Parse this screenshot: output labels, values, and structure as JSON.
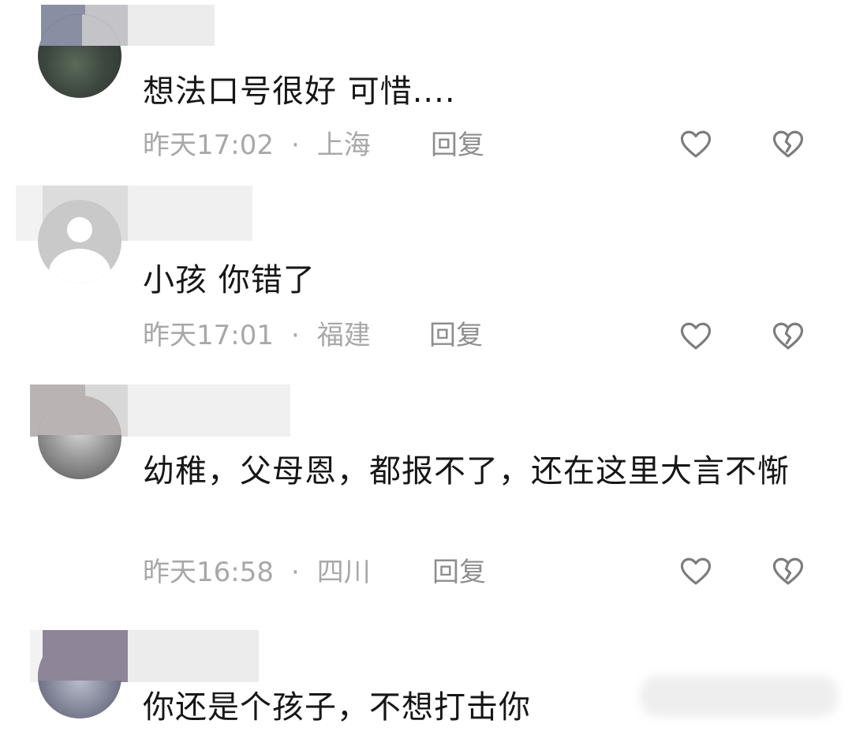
{
  "comments": [
    {
      "text": "想法口号很好 可惜....",
      "time": "昨天17:02",
      "separator": "·",
      "location": "上海",
      "reply_label": "回复",
      "like_icon": "heart-outline-icon",
      "dislike_icon": "broken-heart-icon"
    },
    {
      "text": "小孩 你错了",
      "time": "昨天17:01",
      "separator": "·",
      "location": "福建",
      "reply_label": "回复",
      "like_icon": "heart-outline-icon",
      "dislike_icon": "broken-heart-icon"
    },
    {
      "text": "幼稚，父母恩，都报不了，还在这里大言不惭",
      "time": "昨天16:58",
      "separator": "·",
      "location": "四川",
      "reply_label": "回复",
      "like_icon": "heart-outline-icon",
      "dislike_icon": "broken-heart-icon"
    },
    {
      "text": "你还是个孩子，不想打击你"
    }
  ],
  "colors": {
    "text": "#161616",
    "meta": "#a8a8a8",
    "reply": "#8e8e8e",
    "icon": "#7c7c7c"
  }
}
